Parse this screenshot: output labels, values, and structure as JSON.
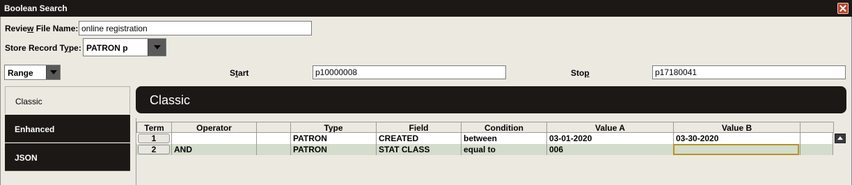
{
  "window": {
    "title": "Boolean Search"
  },
  "form": {
    "review_label_pre": "Revie",
    "review_label_u": "w",
    "review_label_post": " File Name:",
    "review_value": "online registration",
    "record_type_label_pre": "Store Record T",
    "record_type_label_u": "y",
    "record_type_label_post": "pe:",
    "record_type_value": "PATRON  p"
  },
  "range": {
    "mode_value": "Range",
    "start_label_pre": "S",
    "start_label_u": "t",
    "start_label_post": "art",
    "start_value": "p10000008",
    "stop_label_pre": "Sto",
    "stop_label_u": "p",
    "stop_label_post": "",
    "stop_value": "p17180041"
  },
  "sidebar": {
    "tabs": [
      {
        "label": "Classic"
      },
      {
        "label": "Enhanced"
      },
      {
        "label": "JSON"
      }
    ]
  },
  "panel": {
    "title": "Classic"
  },
  "grid": {
    "columns": [
      "Term",
      "Operator",
      "",
      "Type",
      "Field",
      "Condition",
      "Value A",
      "Value B",
      ""
    ],
    "rows": [
      {
        "term": "1",
        "operator": "",
        "type": "PATRON",
        "field": "CREATED",
        "condition": "between",
        "value_a": "03-01-2020",
        "value_b": "03-30-2020"
      },
      {
        "term": "2",
        "operator": "AND",
        "type": "PATRON",
        "field": "STAT CLASS",
        "condition": "equal to",
        "value_a": "006",
        "value_b": ""
      }
    ]
  },
  "colors": {
    "titlebar_bg": "#1c1815",
    "window_bg": "#ece9e1",
    "row_alt_bg": "#d4dccb",
    "focus_border": "#b59423"
  }
}
